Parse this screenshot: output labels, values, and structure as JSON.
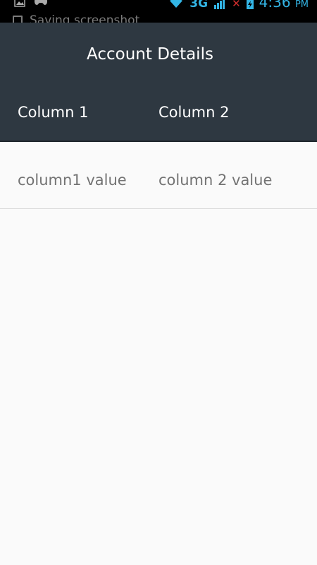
{
  "status_bar": {
    "notification_text": "Saving screenshot",
    "network_label": "3G",
    "time": "4:36",
    "ampm": "PM",
    "icons": [
      "image-icon",
      "gamepad-icon",
      "wifi-icon",
      "signal-icon",
      "no-data-icon",
      "battery-charging-icon"
    ]
  },
  "header": {
    "title": "Account Details",
    "columns": [
      "Column 1",
      "Column 2"
    ]
  },
  "table": {
    "rows": [
      [
        "column1 value",
        "column 2 value"
      ]
    ]
  },
  "colors": {
    "header_bg": "#2e3841",
    "status_accent": "#33b5e5",
    "body_bg": "#fafafa",
    "cell_text": "#737373"
  }
}
